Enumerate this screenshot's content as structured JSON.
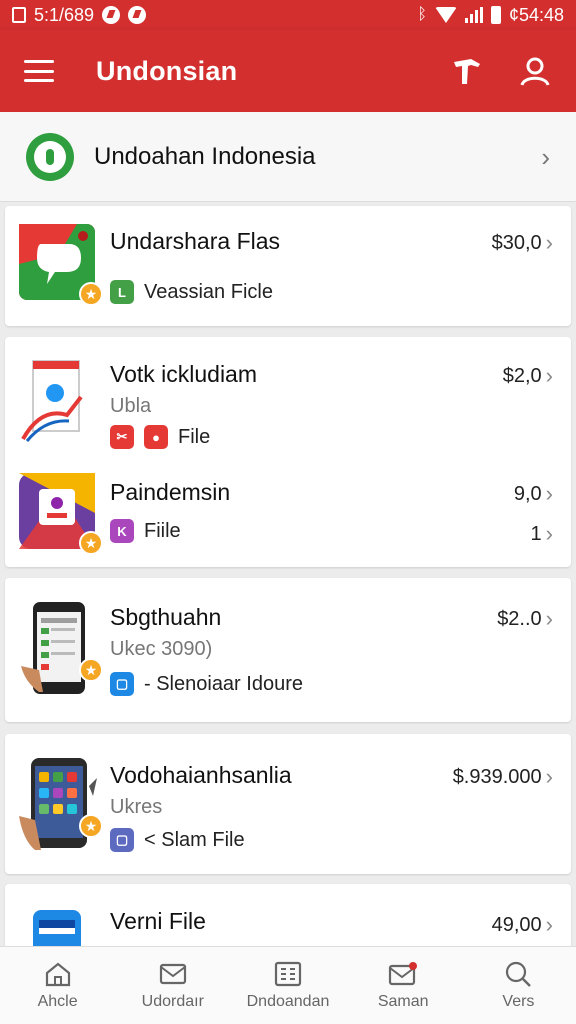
{
  "status_bar": {
    "time_left": "5:1/689",
    "time_right": "¢54:48"
  },
  "app_bar": {
    "title": "Undonsian"
  },
  "banner": {
    "title": "Undoahan Indonesia"
  },
  "items": [
    {
      "title": "Undarshara Flas",
      "meta": "Veassian Ficle",
      "price": "$30,0"
    },
    {
      "title": "Votk ickludiam",
      "subtitle": "Ubla",
      "meta": "File",
      "price": "$2,0"
    },
    {
      "title": "Paindemsin",
      "meta": "Fiile",
      "price": "9,0",
      "count": "1"
    },
    {
      "title": "Sbgthuahn",
      "subtitle": "Ukec 3090)",
      "meta": "- Slenoiaar Idoure",
      "price": "$2..0"
    },
    {
      "title": "Vodohaianhsanlia",
      "subtitle": "Ukres",
      "meta": "< Slam File",
      "price": "$.939.000"
    },
    {
      "title": "Verni File",
      "price": "49,00"
    }
  ],
  "bottom_nav": [
    {
      "label": "Ahcle",
      "icon": "home-icon"
    },
    {
      "label": "Udordaır",
      "icon": "mail-icon"
    },
    {
      "label": "Dndoandan",
      "icon": "grid-icon"
    },
    {
      "label": "Saman",
      "icon": "mail-alert-icon"
    },
    {
      "label": "Vers",
      "icon": "search-icon"
    }
  ],
  "colors": {
    "primary": "#d32f2f",
    "green": "#2e9e3e",
    "star": "#f5a623"
  }
}
